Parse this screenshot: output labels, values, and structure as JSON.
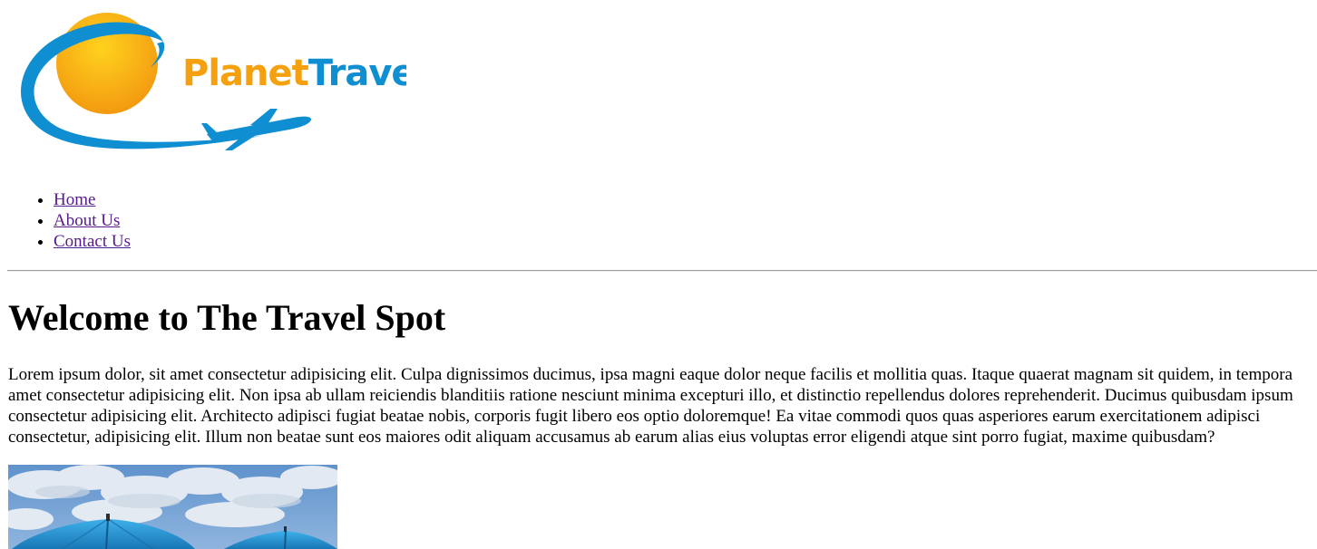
{
  "logo": {
    "text_part1": "Planet",
    "text_part2": "Travel",
    "colors": {
      "orange": "#f5a00e",
      "blue": "#0f8ed2",
      "sun_light": "#ffd21e",
      "sun_dark": "#f39a10"
    }
  },
  "nav": {
    "items": [
      {
        "label": "Home"
      },
      {
        "label": "About Us"
      },
      {
        "label": "Contact Us"
      }
    ]
  },
  "main": {
    "title": "Welcome to The Travel Spot",
    "paragraph_lines": [
      "Lorem ipsum dolor, sit amet consectetur adipisicing elit. Culpa dignissimos ducimus, ipsa magni eaque dolor neque facilis et mollitia quas. Itaque quaerat magnam sit quidem, in tempora",
      "amet consectetur adipisicing elit. Non ipsa ab ullam reiciendis blanditiis ratione nesciunt minima excepturi illo, et distinctio repellendus dolores reprehenderit. Ducimus quibusdam ipsum",
      "consectetur adipisicing elit. Architecto adipisci fugiat beatae nobis, corporis fugit libero eos optio doloremque! Ea vitae commodi quos quas asperiores earum exercitationem adipisci",
      "consectetur, adipisicing elit. Illum non beatae sunt eos maiores odit aliquam accusamus ab earum alias eius voluptas error eligendi atque sint porro fugiat, maxime quibusdam?"
    ]
  },
  "photo": {
    "subject": "blue beach umbrellas under cloudy sky",
    "colors": {
      "sky": "#6f9fd4",
      "cloud": "#e9eef4",
      "umbrella": "#2a9fdd",
      "umbrella_dark": "#1877b5"
    }
  }
}
